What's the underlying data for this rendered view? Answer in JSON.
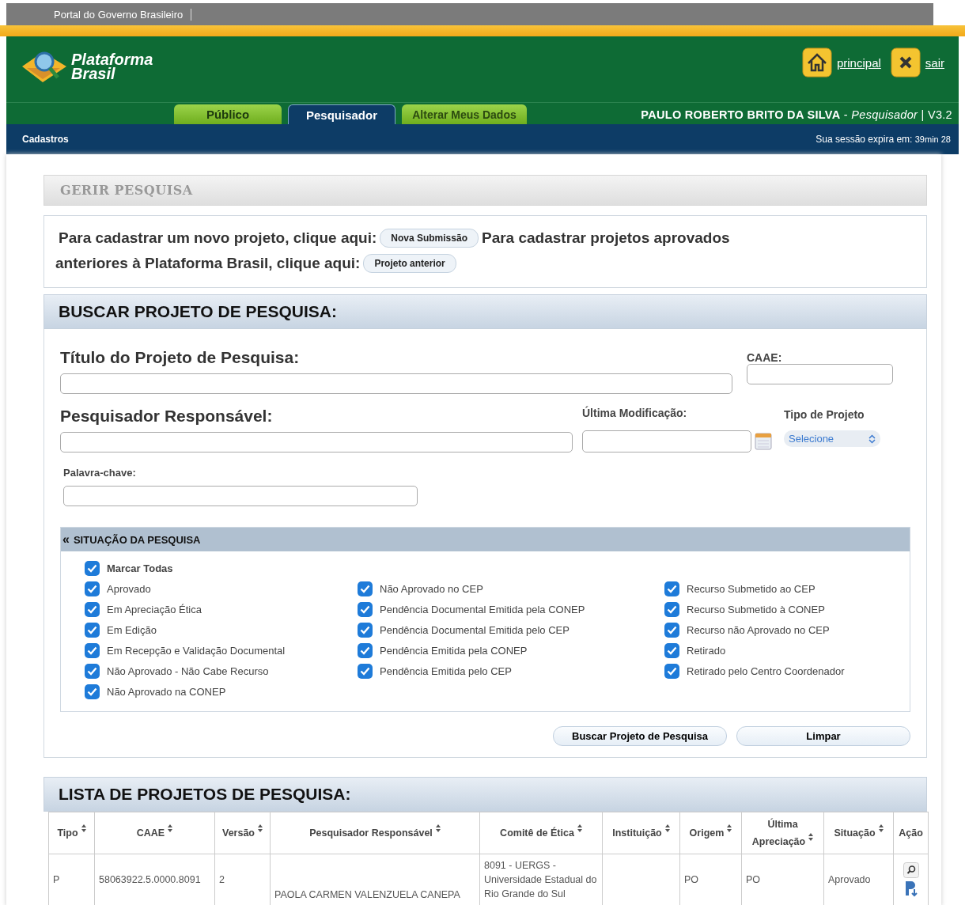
{
  "gov_bar": {
    "label": "Portal do Governo Brasileiro"
  },
  "header": {
    "logo": {
      "line1": "Plataforma",
      "line2": "Brasil"
    },
    "links": [
      {
        "kind": "home",
        "label": "principal"
      },
      {
        "kind": "exit",
        "label": "sair"
      }
    ],
    "tabs": [
      {
        "label": "Público",
        "selected": false
      },
      {
        "label": "Pesquisador",
        "selected": true
      },
      {
        "label": "Alterar Meus Dados",
        "selected": false
      }
    ],
    "user_line": "**PAULO ROBERTO BRITO DA SILVA** - *Pesquisador* | V3.2"
  },
  "nav_bar": {
    "menu": "Cadastros",
    "session_label": "Sua sessão expira em:",
    "session_time": "39min 28"
  },
  "page_title": "GERIR PESQUISA",
  "intro": {
    "text1": "Para cadastrar um novo projeto, clique aqui:",
    "button1": "Nova Submissão",
    "text2": "Para cadastrar projetos aprovados",
    "text3": "anteriores à Plataforma Brasil, clique aqui:",
    "button2": "Projeto anterior"
  },
  "search": {
    "title": "BUSCAR PROJETO DE PESQUISA:",
    "titulo_label": "Título do Projeto de Pesquisa:",
    "caae_label": "CAAE:",
    "pesquisador_label": "Pesquisador Responsável:",
    "modificacao_label": "Última Modificação:",
    "tipo_label": "Tipo de Projeto",
    "tipo_value": "Selecione",
    "palavra_label": "Palavra-chave:",
    "situacao": {
      "title": "SITUAÇÃO DA PESQUISA",
      "collapse": "«",
      "mark_all": {
        "label": "Marcar Todas",
        "checked": true
      },
      "columns": [
        [
          {
            "label": "Aprovado",
            "checked": true
          },
          {
            "label": "Em Apreciação Ética",
            "checked": true
          },
          {
            "label": "Em Edição",
            "checked": true
          },
          {
            "label": "Em Recepção e Validação Documental",
            "checked": true
          },
          {
            "label": "Não Aprovado - Não Cabe Recurso",
            "checked": true
          },
          {
            "label": "Não Aprovado na CONEP",
            "checked": true
          }
        ],
        [
          {
            "label": "Não Aprovado no CEP",
            "checked": true
          },
          {
            "label": "Pendência Documental Emitida pela CONEP",
            "checked": true
          },
          {
            "label": "Pendência Documental Emitida pelo CEP",
            "checked": true
          },
          {
            "label": "Pendência Emitida pela CONEP",
            "checked": true
          },
          {
            "label": "Pendência Emitida pelo CEP",
            "checked": true
          }
        ],
        [
          {
            "label": "Recurso Submetido ao CEP",
            "checked": true
          },
          {
            "label": "Recurso Submetido à CONEP",
            "checked": true
          },
          {
            "label": "Recurso não Aprovado no CEP",
            "checked": true
          },
          {
            "label": "Retirado",
            "checked": true
          },
          {
            "label": "Retirado pelo Centro Coordenador",
            "checked": true
          }
        ]
      ]
    },
    "buttons": [
      "Buscar Projeto de Pesquisa",
      "Limpar"
    ]
  },
  "list": {
    "title": "LISTA DE PROJETOS DE PESQUISA:",
    "columns": [
      {
        "label": "Tipo",
        "sortable": true
      },
      {
        "label": "CAAE",
        "sortable": true
      },
      {
        "label": "Versão",
        "sortable": true
      },
      {
        "label": "Pesquisador Responsável",
        "sortable": true
      },
      {
        "label": "Comitê de Ética",
        "sortable": true
      },
      {
        "label": "Instituição",
        "sortable": true
      },
      {
        "label": "Origem",
        "sortable": true
      },
      {
        "label": "Última Apreciação",
        "sortable": true
      },
      {
        "label": "Situação",
        "sortable": true
      },
      {
        "label": "Ação",
        "sortable": false
      }
    ],
    "rows": [
      {
        "cells": [
          "P",
          "58063922.5.0000.8091",
          "2",
          "PAOLA CARMEN VALENZUELA CANEPA",
          "8091 - UERGS - Universidade Estadual do Rio Grande do Sul",
          "",
          "PO",
          "PO",
          "Aprovado"
        ]
      }
    ]
  }
}
